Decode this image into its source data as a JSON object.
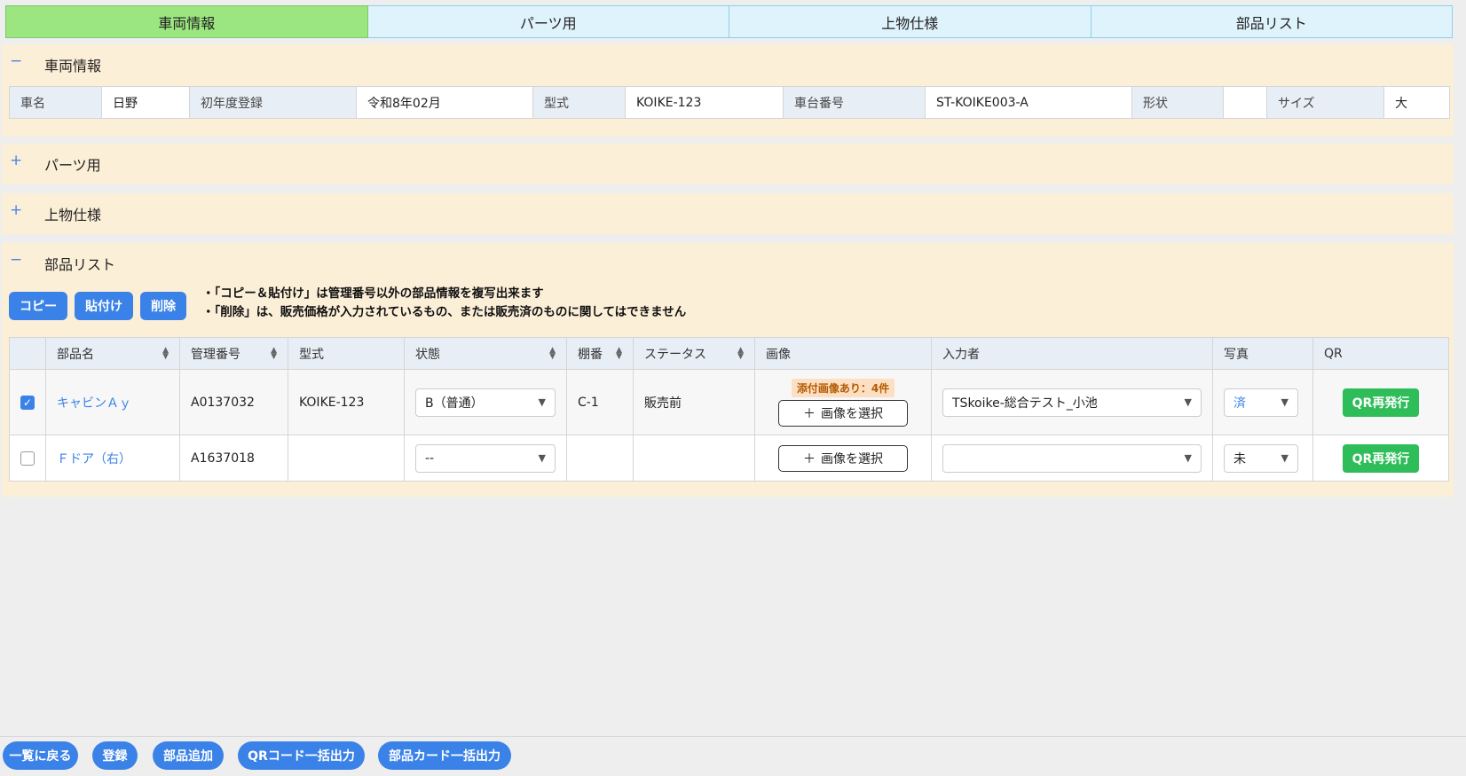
{
  "tabs": [
    "車両情報",
    "パーツ用",
    "上物仕様",
    "部品リスト"
  ],
  "vehicle_section": {
    "toggle": "−",
    "title": "車両情報",
    "fields": [
      {
        "label": "車名",
        "value": "日野"
      },
      {
        "label": "初年度登録",
        "value": "令和8年02月"
      },
      {
        "label": "型式",
        "value": "KOIKE-123"
      },
      {
        "label": "車台番号",
        "value": "ST-KOIKE003-A"
      },
      {
        "label": "形状",
        "value": ""
      },
      {
        "label": "サイズ",
        "value": "大"
      }
    ]
  },
  "parts_section": {
    "toggle": "+",
    "title": "パーツ用"
  },
  "body_section": {
    "toggle": "+",
    "title": "上物仕様"
  },
  "parts_list": {
    "toggle": "−",
    "title": "部品リスト",
    "buttons": {
      "copy": "コピー",
      "paste": "貼付け",
      "delete": "削除"
    },
    "notes": [
      "「コピー＆貼付け」は管理番号以外の部品情報を複写出来ます",
      "「削除」は、販売価格が入力されているもの、または販売済のものに関してはできません"
    ],
    "columns": [
      "部品名",
      "管理番号",
      "型式",
      "状態",
      "棚番",
      "ステータス",
      "画像",
      "入力者",
      "写真",
      "QR"
    ],
    "rows": [
      {
        "checked": true,
        "name": "キャビンＡｙ",
        "mgmt_no": "A0137032",
        "model": "KOIKE-123",
        "condition": "B（普通）",
        "shelf": "C-1",
        "status": "販売前",
        "image_badge": "添付画像あり：4件",
        "image_button": "画像を選択",
        "inputter": "TSkoike-総合テスト_小池",
        "photo": "済",
        "qr_button": "QR再発行"
      },
      {
        "checked": false,
        "name": "Ｆドア（右）",
        "mgmt_no": "A1637018",
        "model": "",
        "condition": "--",
        "shelf": "",
        "status": "",
        "image_badge": "",
        "image_button": "画像を選択",
        "inputter": "",
        "photo": "未",
        "qr_button": "QR再発行"
      }
    ]
  },
  "footer": [
    "一覧に戻る",
    "登録",
    "部品追加",
    "QRコード一括出力",
    "部品カード一括出力"
  ],
  "colors": {
    "active_tab": "#9be680",
    "accent_blue": "#3b82e8",
    "qr_green": "#2ebd59",
    "section_bg": "#fcefd8"
  }
}
